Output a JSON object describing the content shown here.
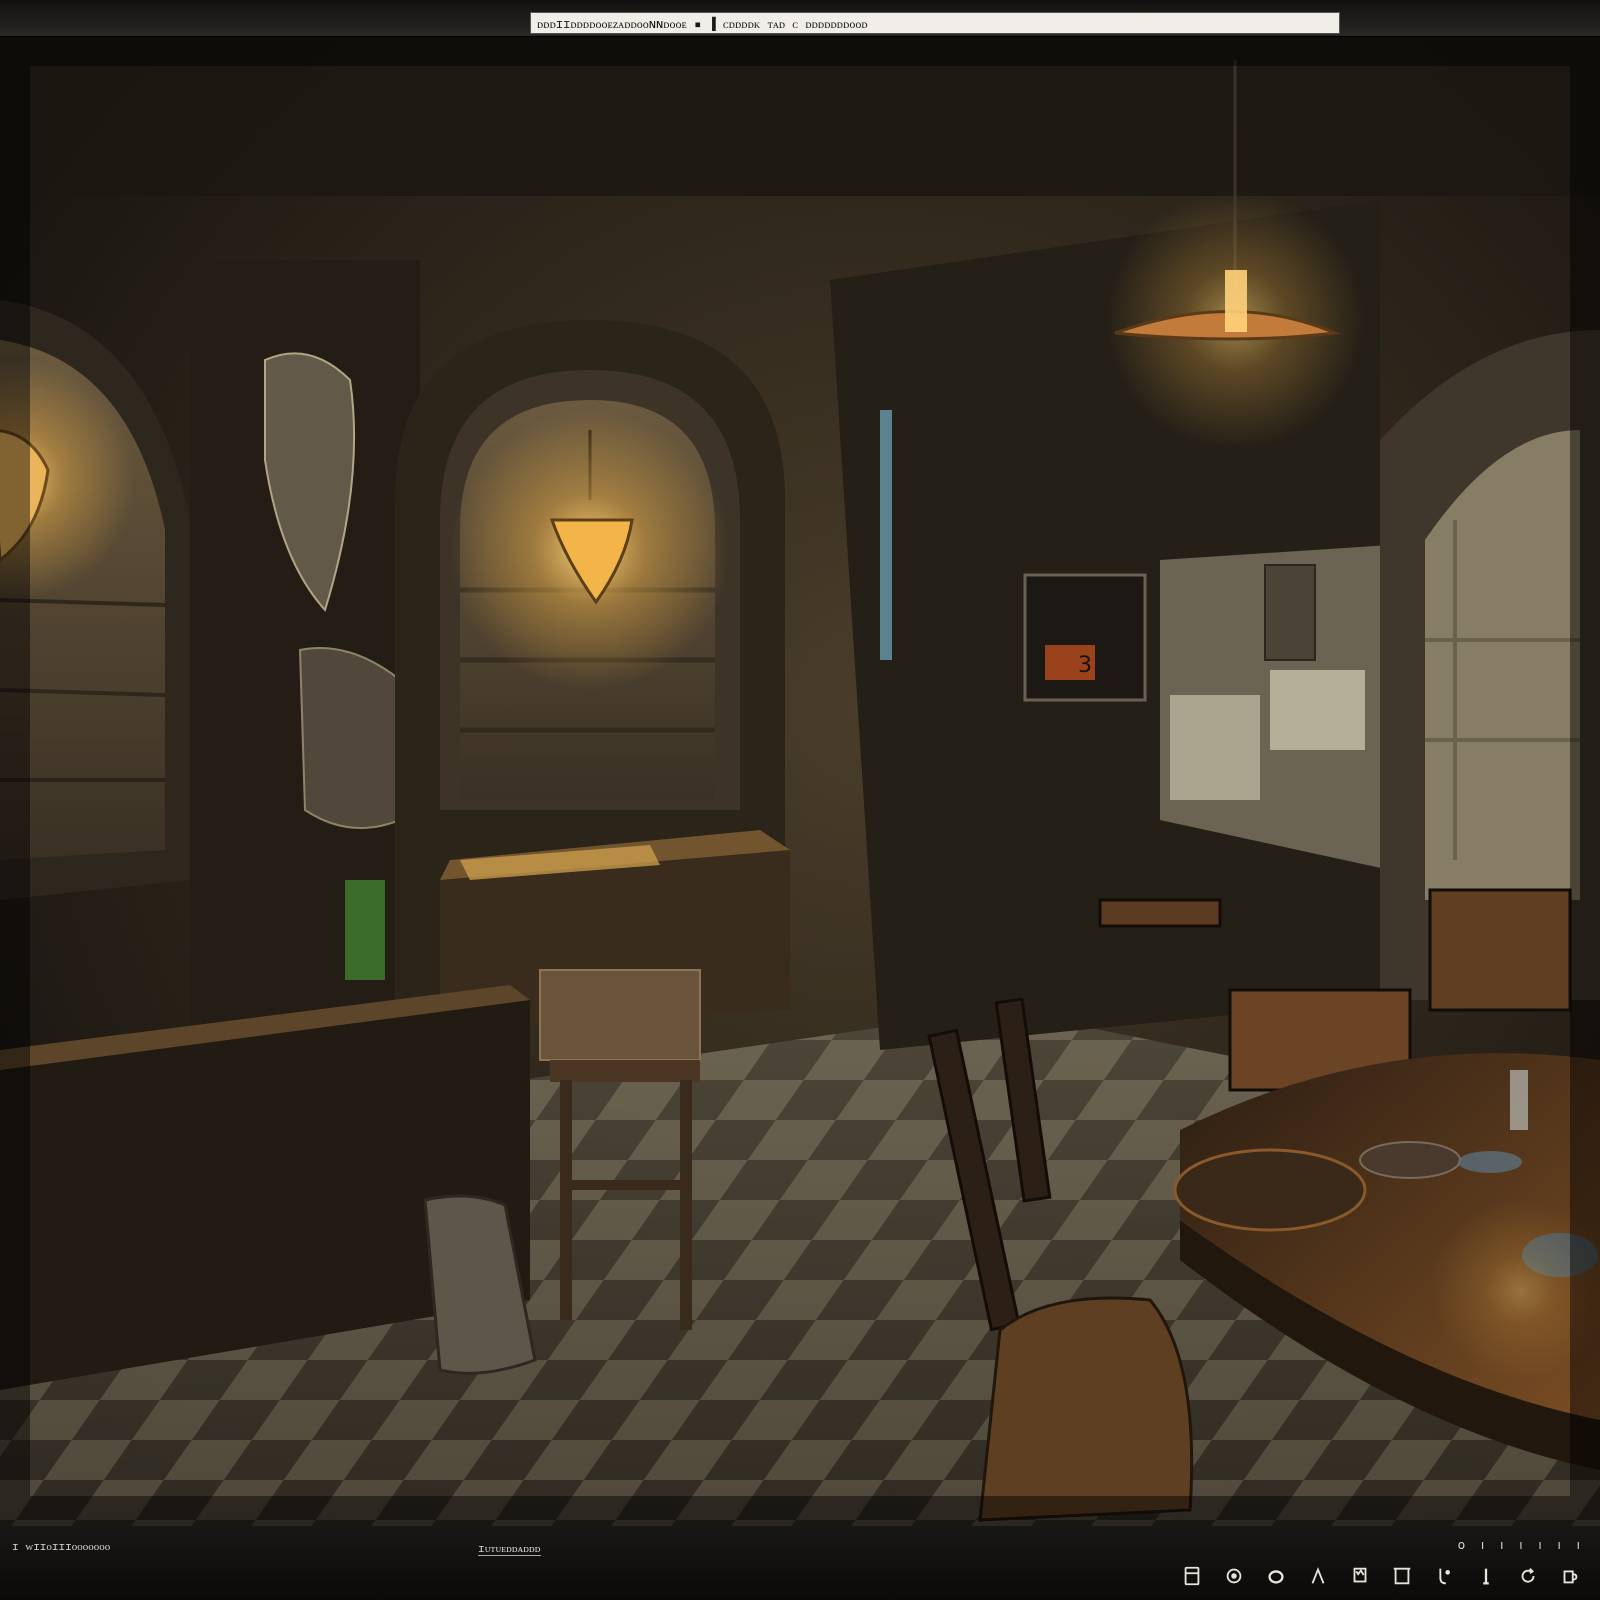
{
  "window": {
    "title": "ᴅᴅᴅɪɪᴅᴅᴅᴅᴏᴏᴇᴢᴀᴅᴅᴏᴏɴɴᴅᴏᴏᴇ ▪ ▐ ᴄᴅᴅᴅᴅᴋ ᴛᴀᴅ ᴄ ᴅᴅᴅᴅᴅᴅᴅᴏᴏᴅ"
  },
  "scene": {
    "description_label": "",
    "wall_sign": "3"
  },
  "status": {
    "left": "ɪ ᴡɪɪᴏɪɪɪᴏᴏᴏᴏᴏᴏᴏ",
    "middle": "ɪᴜᴛᴜᴇᴅᴅᴀᴅᴅᴅ",
    "right_indicators": "o ı ı ı ı ı ı"
  },
  "toolbar": {
    "icons": [
      "book-icon",
      "circle-icon",
      "ring-icon",
      "a-icon",
      "card-icon",
      "box-icon",
      "hook-icon",
      "pipe-icon",
      "refresh-icon",
      "mug-icon"
    ]
  },
  "colors": {
    "lamp_glow": "#f3b54a",
    "wall_dark": "#2a241b",
    "floor_light": "#8d846c",
    "floor_dark": "#3b352b",
    "table_wood": "#5a3a1f"
  }
}
